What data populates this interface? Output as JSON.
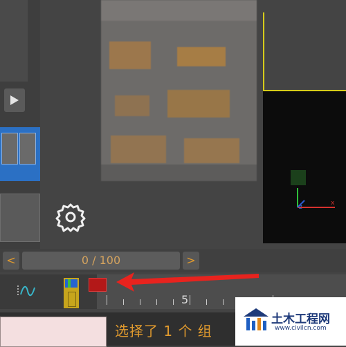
{
  "frame_counter": {
    "current": "0",
    "separator": "/",
    "total": "100",
    "display": "0 / 100",
    "prev_label": "<",
    "next_label": ">"
  },
  "timeline": {
    "tick_label": "5"
  },
  "status": {
    "selection_text": "选择了 1 个 组"
  },
  "watermark": {
    "title": "土木工程网",
    "url": "www.civilcn.com"
  },
  "colors": {
    "accent": "#e09a2e",
    "selection_panel": "#2b70c4",
    "viewport_border": "#d6cc1a",
    "keyframe_red": "#b31818",
    "keyframe_yellow": "#c7a51c",
    "annotation_arrow": "#e8231e"
  },
  "icons": {
    "play": "play-icon",
    "settings": "gear-icon",
    "curve": "curve-editor-icon",
    "axis": "axis-gizmo-icon"
  }
}
